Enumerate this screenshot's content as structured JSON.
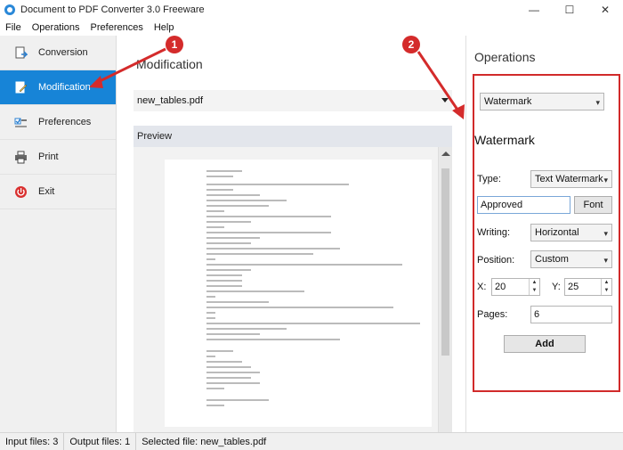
{
  "window": {
    "title": "Document to PDF Converter 3.0 Freeware",
    "minimize": "—",
    "maximize": "☐",
    "close": "✕"
  },
  "menu": [
    "File",
    "Operations",
    "Preferences",
    "Help"
  ],
  "sidebar": {
    "items": [
      {
        "label": "Conversion",
        "icon": "conversion-icon"
      },
      {
        "label": "Modification",
        "icon": "edit-icon"
      },
      {
        "label": "Preferences",
        "icon": "checkbox-icon"
      },
      {
        "label": "Print",
        "icon": "printer-icon"
      },
      {
        "label": "Exit",
        "icon": "power-icon"
      }
    ]
  },
  "main": {
    "title": "Modification",
    "selected_file": "new_tables.pdf",
    "preview_label": "Preview"
  },
  "operations": {
    "title": "Operations",
    "operation_value": "Watermark",
    "section_title": "Watermark",
    "type_label": "Type:",
    "type_value": "Text Watermark",
    "text_value": "Approved",
    "font_button": "Font",
    "writing_label": "Writing:",
    "writing_value": "Horizontal",
    "position_label": "Position:",
    "position_value": "Custom",
    "x_label": "X:",
    "x_value": "20",
    "y_label": "Y:",
    "y_value": "25",
    "pages_label": "Pages:",
    "pages_value": "6",
    "add_button": "Add"
  },
  "status": {
    "input_files": "Input files: 3",
    "output_files": "Output files: 1",
    "selected": "Selected file: new_tables.pdf"
  },
  "callouts": {
    "first": "1",
    "second": "2"
  },
  "colors": {
    "accent": "#1784d7",
    "highlight": "#d12a2a"
  }
}
